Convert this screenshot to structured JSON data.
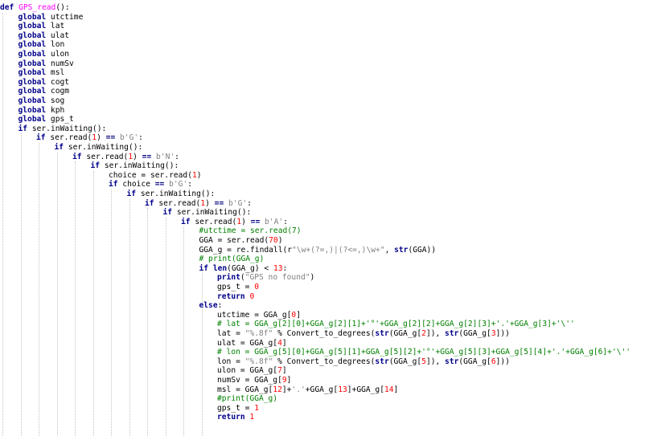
{
  "editor": {
    "language": "python",
    "colors": {
      "keyword": "#00008b",
      "function_name": "#ff00ff",
      "number": "#ff0000",
      "string": "#808080",
      "comment": "#008000",
      "operator": "#000080",
      "plain": "#000000",
      "indent_guide": "#c4c4c4",
      "background": "#ffffff"
    },
    "lines": [
      {
        "indent": 0,
        "tokens": [
          [
            "kw",
            "def"
          ],
          [
            "pl",
            " "
          ],
          [
            "fn",
            "GPS_read"
          ],
          [
            "pl",
            "():"
          ]
        ]
      },
      {
        "indent": 1,
        "tokens": [
          [
            "kw",
            "global"
          ],
          [
            "pl",
            " utctime"
          ]
        ]
      },
      {
        "indent": 1,
        "tokens": [
          [
            "kw",
            "global"
          ],
          [
            "pl",
            " lat"
          ]
        ]
      },
      {
        "indent": 1,
        "tokens": [
          [
            "kw",
            "global"
          ],
          [
            "pl",
            " ulat"
          ]
        ]
      },
      {
        "indent": 1,
        "tokens": [
          [
            "kw",
            "global"
          ],
          [
            "pl",
            " lon"
          ]
        ]
      },
      {
        "indent": 1,
        "tokens": [
          [
            "kw",
            "global"
          ],
          [
            "pl",
            " ulon"
          ]
        ]
      },
      {
        "indent": 1,
        "tokens": [
          [
            "kw",
            "global"
          ],
          [
            "pl",
            " numSv"
          ]
        ]
      },
      {
        "indent": 1,
        "tokens": [
          [
            "kw",
            "global"
          ],
          [
            "pl",
            " msl"
          ]
        ]
      },
      {
        "indent": 1,
        "tokens": [
          [
            "kw",
            "global"
          ],
          [
            "pl",
            " cogt"
          ]
        ]
      },
      {
        "indent": 1,
        "tokens": [
          [
            "kw",
            "global"
          ],
          [
            "pl",
            " cogm"
          ]
        ]
      },
      {
        "indent": 1,
        "tokens": [
          [
            "kw",
            "global"
          ],
          [
            "pl",
            " sog"
          ]
        ]
      },
      {
        "indent": 1,
        "tokens": [
          [
            "kw",
            "global"
          ],
          [
            "pl",
            " kph"
          ]
        ]
      },
      {
        "indent": 1,
        "tokens": [
          [
            "kw",
            "global"
          ],
          [
            "pl",
            " gps_t"
          ]
        ]
      },
      {
        "indent": 1,
        "tokens": [
          [
            "kw",
            "if"
          ],
          [
            "pl",
            " ser.inWaiting():"
          ]
        ]
      },
      {
        "indent": 2,
        "tokens": [
          [
            "kw",
            "if"
          ],
          [
            "pl",
            " ser.read("
          ],
          [
            "num",
            "1"
          ],
          [
            "pl",
            ") "
          ],
          [
            "op",
            "=="
          ],
          [
            "pl",
            " "
          ],
          [
            "str",
            "b'G'"
          ],
          [
            "pl",
            ":"
          ]
        ]
      },
      {
        "indent": 3,
        "tokens": [
          [
            "kw",
            "if"
          ],
          [
            "pl",
            " ser.inWaiting():"
          ]
        ]
      },
      {
        "indent": 4,
        "tokens": [
          [
            "kw",
            "if"
          ],
          [
            "pl",
            " ser.read("
          ],
          [
            "num",
            "1"
          ],
          [
            "pl",
            ") "
          ],
          [
            "op",
            "=="
          ],
          [
            "pl",
            " "
          ],
          [
            "str",
            "b'N'"
          ],
          [
            "pl",
            ":"
          ]
        ]
      },
      {
        "indent": 5,
        "tokens": [
          [
            "kw",
            "if"
          ],
          [
            "pl",
            " ser.inWaiting():"
          ]
        ]
      },
      {
        "indent": 6,
        "tokens": [
          [
            "pl",
            "choice = ser.read("
          ],
          [
            "num",
            "1"
          ],
          [
            "pl",
            ")"
          ]
        ]
      },
      {
        "indent": 6,
        "tokens": [
          [
            "kw",
            "if"
          ],
          [
            "pl",
            " choice "
          ],
          [
            "op",
            "=="
          ],
          [
            "pl",
            " "
          ],
          [
            "str",
            "b'G'"
          ],
          [
            "pl",
            ":"
          ]
        ]
      },
      {
        "indent": 7,
        "tokens": [
          [
            "kw",
            "if"
          ],
          [
            "pl",
            " ser.inWaiting():"
          ]
        ]
      },
      {
        "indent": 8,
        "tokens": [
          [
            "kw",
            "if"
          ],
          [
            "pl",
            " ser.read("
          ],
          [
            "num",
            "1"
          ],
          [
            "pl",
            ") "
          ],
          [
            "op",
            "=="
          ],
          [
            "pl",
            " "
          ],
          [
            "str",
            "b'G'"
          ],
          [
            "pl",
            ":"
          ]
        ]
      },
      {
        "indent": 9,
        "tokens": [
          [
            "kw",
            "if"
          ],
          [
            "pl",
            " ser.inWaiting():"
          ]
        ]
      },
      {
        "indent": 10,
        "tokens": [
          [
            "kw",
            "if"
          ],
          [
            "pl",
            " ser.read("
          ],
          [
            "num",
            "1"
          ],
          [
            "pl",
            ") "
          ],
          [
            "op",
            "=="
          ],
          [
            "pl",
            " "
          ],
          [
            "str",
            "b'A'"
          ],
          [
            "pl",
            ":"
          ]
        ]
      },
      {
        "indent": 11,
        "tokens": [
          [
            "cmt",
            "#utctime = ser.read(7)"
          ]
        ]
      },
      {
        "indent": 11,
        "tokens": [
          [
            "pl",
            "GGA = ser.read("
          ],
          [
            "num",
            "70"
          ],
          [
            "pl",
            ")"
          ]
        ]
      },
      {
        "indent": 11,
        "tokens": [
          [
            "pl",
            "GGA_g = re.findall(r"
          ],
          [
            "str",
            "\"\\w+(?=,)|(?<=,)\\w+\""
          ],
          [
            "pl",
            ", "
          ],
          [
            "kw",
            "str"
          ],
          [
            "pl",
            "(GGA))"
          ]
        ]
      },
      {
        "indent": 11,
        "tokens": [
          [
            "cmt",
            "# print(GGA_g)"
          ]
        ]
      },
      {
        "indent": 11,
        "tokens": [
          [
            "kw",
            "if"
          ],
          [
            "pl",
            " "
          ],
          [
            "kw",
            "len"
          ],
          [
            "pl",
            "(GGA_g) < "
          ],
          [
            "num",
            "13"
          ],
          [
            "pl",
            ":"
          ]
        ]
      },
      {
        "indent": 12,
        "tokens": [
          [
            "kw",
            "print"
          ],
          [
            "pl",
            "("
          ],
          [
            "str",
            "\"GPS no found\""
          ],
          [
            "pl",
            ")"
          ]
        ]
      },
      {
        "indent": 12,
        "tokens": [
          [
            "pl",
            "gps_t = "
          ],
          [
            "num",
            "0"
          ]
        ]
      },
      {
        "indent": 12,
        "tokens": [
          [
            "kw",
            "return"
          ],
          [
            "pl",
            " "
          ],
          [
            "num",
            "0"
          ]
        ]
      },
      {
        "indent": 11,
        "tokens": [
          [
            "kw",
            "else"
          ],
          [
            "pl",
            ":"
          ]
        ]
      },
      {
        "indent": 12,
        "tokens": [
          [
            "pl",
            "utctime = GGA_g["
          ],
          [
            "num",
            "0"
          ],
          [
            "pl",
            "]"
          ]
        ]
      },
      {
        "indent": 12,
        "tokens": [
          [
            "cmt",
            "# lat = GGA_g[2][0]+GGA_g[2][1]+'°'+GGA_g[2][2]+GGA_g[2][3]+'.'+GGA_g[3]+'\\''"
          ]
        ]
      },
      {
        "indent": 12,
        "tokens": [
          [
            "pl",
            "lat = "
          ],
          [
            "str",
            "\"%.8f\""
          ],
          [
            "pl",
            " % Convert_to_degrees("
          ],
          [
            "kw",
            "str"
          ],
          [
            "pl",
            "(GGA_g["
          ],
          [
            "num",
            "2"
          ],
          [
            "pl",
            "]), "
          ],
          [
            "kw",
            "str"
          ],
          [
            "pl",
            "(GGA_g["
          ],
          [
            "num",
            "3"
          ],
          [
            "pl",
            "]))"
          ]
        ]
      },
      {
        "indent": 12,
        "tokens": [
          [
            "pl",
            "ulat = GGA_g["
          ],
          [
            "num",
            "4"
          ],
          [
            "pl",
            "]"
          ]
        ]
      },
      {
        "indent": 12,
        "tokens": [
          [
            "cmt",
            "# lon = GGA_g[5][0]+GGA_g[5][1]+GGA_g[5][2]+'°'+GGA_g[5][3]+GGA_g[5][4]+'.'+GGA_g[6]+'\\''"
          ]
        ]
      },
      {
        "indent": 12,
        "tokens": [
          [
            "pl",
            "lon = "
          ],
          [
            "str",
            "\"%.8f\""
          ],
          [
            "pl",
            " % Convert_to_degrees("
          ],
          [
            "kw",
            "str"
          ],
          [
            "pl",
            "(GGA_g["
          ],
          [
            "num",
            "5"
          ],
          [
            "pl",
            "]), "
          ],
          [
            "kw",
            "str"
          ],
          [
            "pl",
            "(GGA_g["
          ],
          [
            "num",
            "6"
          ],
          [
            "pl",
            "]))"
          ]
        ]
      },
      {
        "indent": 12,
        "tokens": [
          [
            "pl",
            "ulon = GGA_g["
          ],
          [
            "num",
            "7"
          ],
          [
            "pl",
            "]"
          ]
        ]
      },
      {
        "indent": 12,
        "tokens": [
          [
            "pl",
            "numSv = GGA_g["
          ],
          [
            "num",
            "9"
          ],
          [
            "pl",
            "]"
          ]
        ]
      },
      {
        "indent": 12,
        "tokens": [
          [
            "pl",
            "msl = GGA_g["
          ],
          [
            "num",
            "12"
          ],
          [
            "pl",
            "]+"
          ],
          [
            "str",
            "'.'"
          ],
          [
            "pl",
            "+GGA_g["
          ],
          [
            "num",
            "13"
          ],
          [
            "pl",
            "]+GGA_g["
          ],
          [
            "num",
            "14"
          ],
          [
            "pl",
            "]"
          ]
        ]
      },
      {
        "indent": 12,
        "tokens": [
          [
            "cmt",
            "#print(GGA_g)"
          ]
        ]
      },
      {
        "indent": 12,
        "tokens": [
          [
            "pl",
            "gps_t = "
          ],
          [
            "num",
            "1"
          ]
        ]
      },
      {
        "indent": 12,
        "tokens": [
          [
            "kw",
            "return"
          ],
          [
            "pl",
            " "
          ],
          [
            "num",
            "1"
          ]
        ]
      }
    ]
  }
}
